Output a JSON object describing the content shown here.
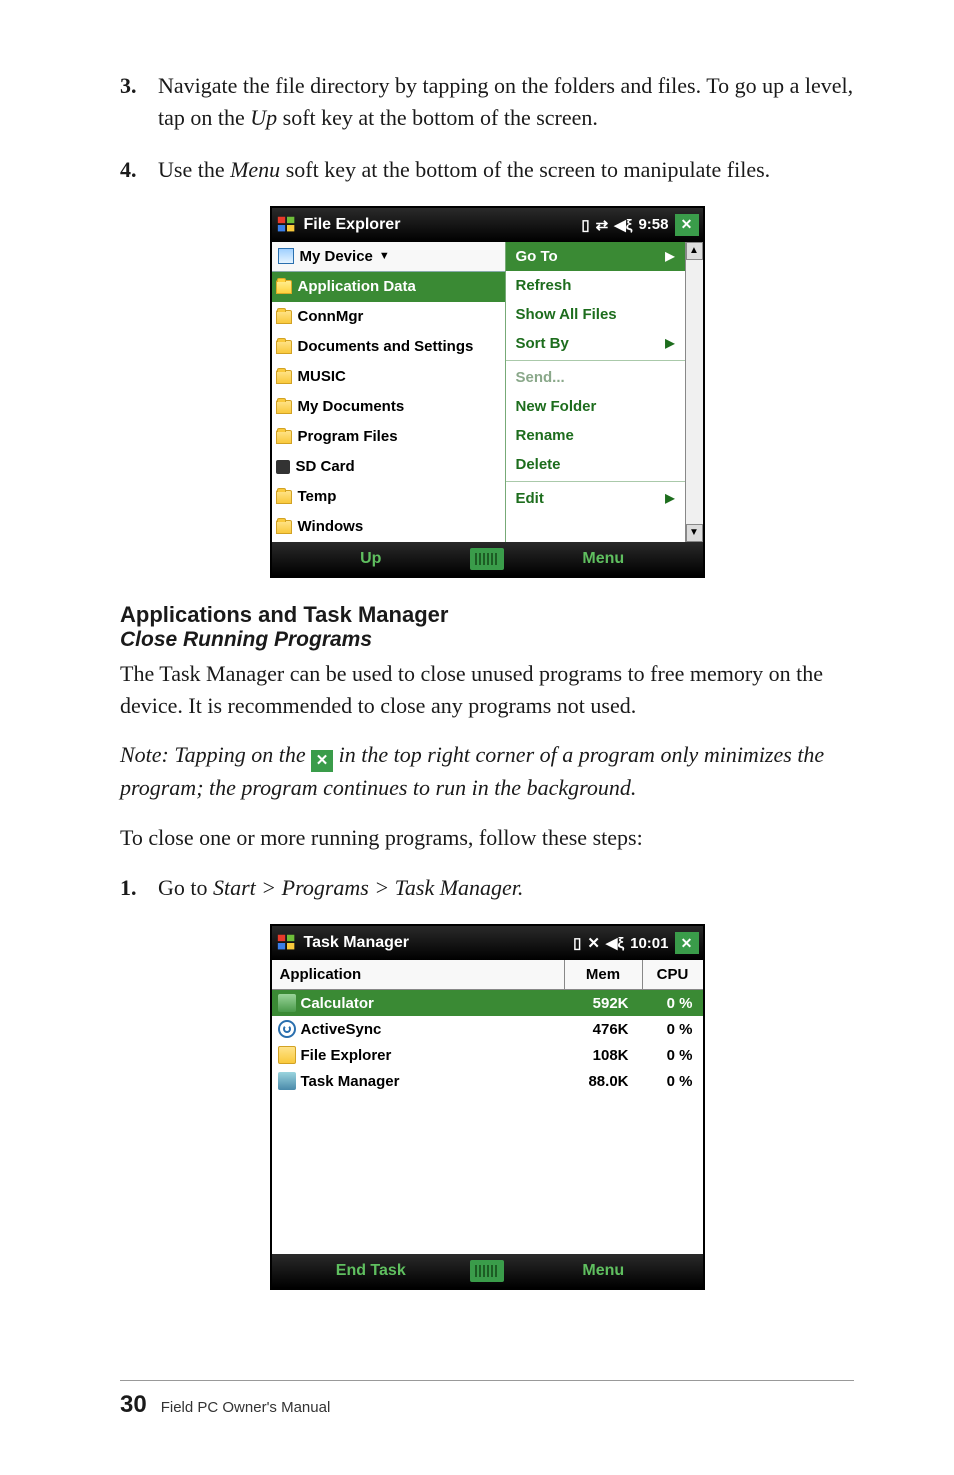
{
  "instructions": {
    "step3_num": "3.",
    "step3_a": "Navigate the file directory by tapping on the folders and files. To go up a level, tap on the ",
    "step3_em": "Up",
    "step3_b": " soft key at the bottom of the screen.",
    "step4_num": "4.",
    "step4_a": "Use the ",
    "step4_em": "Menu",
    "step4_b": " soft key at the bottom of the screen to manipulate files."
  },
  "file_explorer": {
    "title": "File Explorer",
    "clock": "9:58",
    "device_label": "My Device",
    "folders": [
      "Application Data",
      "ConnMgr",
      "Documents and Settings",
      "MUSIC",
      "My Documents",
      "Program Files",
      "SD Card",
      "Temp",
      "Windows"
    ],
    "menu": {
      "goto": "Go To",
      "refresh": "Refresh",
      "show_all": "Show All Files",
      "sort_by": "Sort By",
      "send": "Send...",
      "new_folder": "New Folder",
      "rename": "Rename",
      "delete": "Delete",
      "edit": "Edit"
    },
    "soft_left": "Up",
    "soft_right": "Menu"
  },
  "section": {
    "heading": "Applications and Task Manager",
    "sub": "Close Running Programs",
    "para": "The Task Manager can be used to close unused programs to free memory on the device. It is recommended to close any programs not used.",
    "note_a": "Note: Tapping on the ",
    "note_b": " in the top right corner of a program only minimizes the program; the program continues to run in the background.",
    "para2": "To close one or more running programs, follow these steps:",
    "step1_num": "1.",
    "step1_a": "Go to ",
    "step1_em": "Start > Programs > Task Manager."
  },
  "task_manager": {
    "title": "Task Manager",
    "clock": "10:01",
    "col_app": "Application",
    "col_mem": "Mem",
    "col_cpu": "CPU",
    "rows": [
      {
        "name": "Calculator",
        "mem": "592K",
        "cpu": "0 %"
      },
      {
        "name": "ActiveSync",
        "mem": "476K",
        "cpu": "0 %"
      },
      {
        "name": "File Explorer",
        "mem": "108K",
        "cpu": "0 %"
      },
      {
        "name": "Task Manager",
        "mem": "88.0K",
        "cpu": "0 %"
      }
    ],
    "soft_left": "End Task",
    "soft_right": "Menu"
  },
  "footer": {
    "page_num": "30",
    "title": "Field PC Owner's Manual"
  }
}
